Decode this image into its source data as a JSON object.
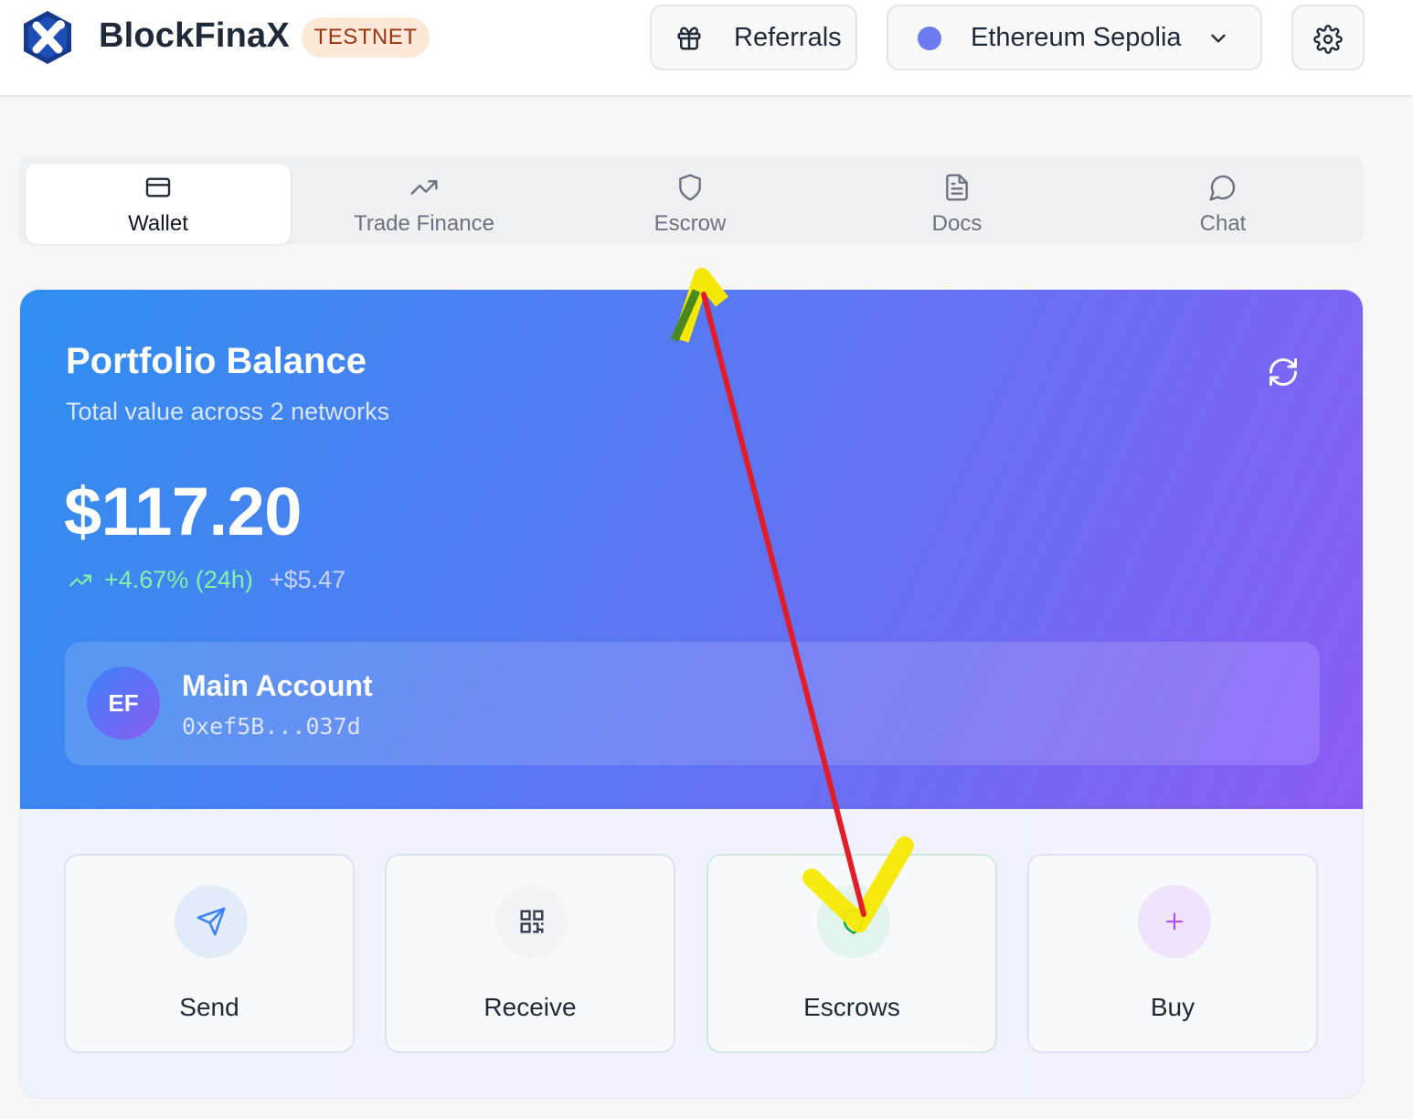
{
  "header": {
    "brand": "BlockFinaX",
    "env_badge": "TESTNET",
    "referrals_label": "Referrals",
    "network_label": "Ethereum Sepolia",
    "network_color": "#6b7cf0",
    "settings_icon": "gear-icon"
  },
  "tabs": [
    {
      "label": "Wallet",
      "icon": "card-icon",
      "active": true
    },
    {
      "label": "Trade Finance",
      "icon": "trending-up-icon",
      "active": false
    },
    {
      "label": "Escrow",
      "icon": "shield-icon",
      "active": false
    },
    {
      "label": "Docs",
      "icon": "document-icon",
      "active": false
    },
    {
      "label": "Chat",
      "icon": "chat-bubble-icon",
      "active": false
    }
  ],
  "portfolio": {
    "title": "Portfolio Balance",
    "subtitle": "Total value across 2 networks",
    "balance": "$117.20",
    "change_pct": "+4.67% (24h)",
    "change_abs": "+$5.47"
  },
  "account": {
    "initials": "EF",
    "name": "Main Account",
    "address": "0xef5B...037d"
  },
  "actions": [
    {
      "label": "Send",
      "icon": "send-icon",
      "color": "#3b82f6"
    },
    {
      "label": "Receive",
      "icon": "qr-code-icon",
      "color": "#374151"
    },
    {
      "label": "Escrows",
      "icon": "shield-icon",
      "color": "#16a34a"
    },
    {
      "label": "Buy",
      "icon": "plus-icon",
      "color": "#a855f7"
    }
  ],
  "colors": {
    "accent_blue": "#2f8ff0",
    "accent_purple": "#8b5cf6",
    "positive": "#86efac",
    "annotation_arrow": "#e11d2a",
    "annotation_highlight": "#f5e800"
  }
}
